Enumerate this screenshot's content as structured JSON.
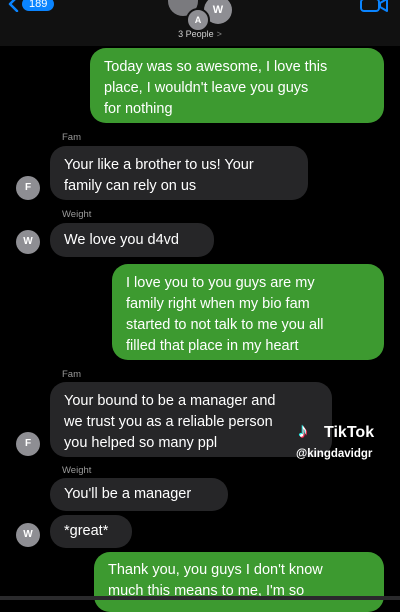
{
  "header": {
    "back_count": "189",
    "avatars": [
      "A",
      "W"
    ],
    "people_label": "3 People",
    "chevron": ">"
  },
  "messages": [
    {
      "sender": "",
      "avatar": "",
      "text": [
        "Today was so awesome, I love this",
        "place, I wouldn't leave you guys",
        "for nothing"
      ]
    },
    {
      "sender": "Fam",
      "avatar": "F",
      "text": [
        "Your like a brother to us! Your",
        "family can rely on us"
      ]
    },
    {
      "sender": "Weight",
      "avatar": "W",
      "text": [
        "We love you d4vd"
      ]
    },
    {
      "sender": "",
      "avatar": "",
      "text": [
        "I love you to you guys are my",
        "family right when my bio fam",
        "started to not talk to me you all",
        "filled that place in my heart"
      ]
    },
    {
      "sender": "Fam",
      "avatar": "F",
      "text": [
        "Your bound to be a manager and",
        "we trust you as a reliable person",
        "you helped so many ppl"
      ]
    },
    {
      "sender": "Weight",
      "avatar": "",
      "text": [
        "You'll be a manager"
      ]
    },
    {
      "sender": "",
      "avatar": "W",
      "text": [
        "*great*"
      ]
    },
    {
      "sender": "",
      "avatar": "",
      "text": [
        "Thank you, you guys I don't know",
        "much this means to me, I'm so"
      ]
    }
  ],
  "watermark": {
    "brand": "TikTok",
    "handle": "@kingdavidgr"
  },
  "colors": {
    "outgoing": "#3d9a30",
    "incoming": "#262628",
    "accent": "#0a84ff"
  }
}
